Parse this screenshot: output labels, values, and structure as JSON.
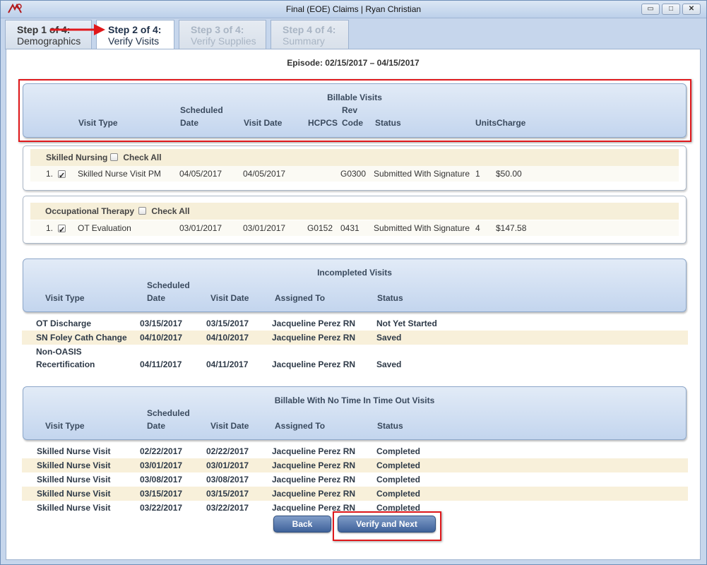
{
  "window": {
    "title": "Final (EOE) Claims | Ryan Christian",
    "minimize": "▭",
    "maximize": "□",
    "close": "✕"
  },
  "tabs": [
    {
      "step": "Step 1 of 4:",
      "name": "Demographics",
      "state": "done"
    },
    {
      "step": "Step 2 of 4:",
      "name": "Verify Visits",
      "state": "active"
    },
    {
      "step": "Step 3 of 4:",
      "name": "Verify Supplies",
      "state": "disabled"
    },
    {
      "step": "Step 4 of 4:",
      "name": "Summary",
      "state": "disabled"
    }
  ],
  "episode": "Episode: 02/15/2017 – 04/15/2017",
  "billable": {
    "title": "Billable Visits",
    "columns": {
      "visit_type": "Visit Type",
      "scheduled_1": "Scheduled",
      "scheduled_2": "Date",
      "visit_date": "Visit Date",
      "hcpcs": "HCPCS",
      "rev_1": "Rev",
      "rev_2": "Code",
      "status": "Status",
      "units": "Units",
      "charge": "Charge"
    },
    "groups": [
      {
        "name": "Skilled Nursing",
        "check_all": "Check All",
        "rows": [
          {
            "num": "1.",
            "checked": true,
            "visit_type": "Skilled Nurse Visit PM",
            "scheduled": "04/05/2017",
            "visit_date": "04/05/2017",
            "hcpcs": "",
            "rev": "G0300",
            "status": "Submitted With Signature",
            "units": "1",
            "charge": "$50.00"
          }
        ]
      },
      {
        "name": "Occupational Therapy",
        "check_all": "Check All",
        "rows": [
          {
            "num": "1.",
            "checked": true,
            "visit_type": "OT Evaluation",
            "scheduled": "03/01/2017",
            "visit_date": "03/01/2017",
            "hcpcs": "G0152",
            "rev": "0431",
            "status": "Submitted With Signature",
            "units": "4",
            "charge": "$147.58"
          }
        ]
      }
    ]
  },
  "incompleted": {
    "title": "Incompleted Visits",
    "columns": {
      "visit_type": "Visit Type",
      "scheduled_1": "Scheduled",
      "scheduled_2": "Date",
      "visit_date": "Visit Date",
      "assigned": "Assigned To",
      "status": "Status"
    },
    "rows": [
      {
        "visit_type": "OT Discharge",
        "visit_type_2": "",
        "scheduled": "03/15/2017",
        "visit_date": "03/15/2017",
        "assigned": "Jacqueline Perez RN",
        "status": "Not Yet Started"
      },
      {
        "visit_type": "SN Foley Cath Change",
        "visit_type_2": "",
        "scheduled": "04/10/2017",
        "visit_date": "04/10/2017",
        "assigned": "Jacqueline Perez RN",
        "status": "Saved"
      },
      {
        "visit_type": "Non-OASIS",
        "visit_type_2": "Recertification",
        "scheduled": "04/11/2017",
        "visit_date": "04/11/2017",
        "assigned": "Jacqueline Perez RN",
        "status": "Saved"
      }
    ]
  },
  "notime": {
    "title": "Billable With No Time In Time Out Visits",
    "columns": {
      "visit_type": "Visit Type",
      "scheduled_1": "Scheduled",
      "scheduled_2": "Date",
      "visit_date": "Visit Date",
      "assigned": "Assigned To",
      "status": "Status"
    },
    "rows": [
      {
        "visit_type": "Skilled Nurse Visit",
        "scheduled": "02/22/2017",
        "visit_date": "02/22/2017",
        "assigned": "Jacqueline Perez RN",
        "status": "Completed"
      },
      {
        "visit_type": "Skilled Nurse Visit",
        "scheduled": "03/01/2017",
        "visit_date": "03/01/2017",
        "assigned": "Jacqueline Perez RN",
        "status": "Completed"
      },
      {
        "visit_type": "Skilled Nurse Visit",
        "scheduled": "03/08/2017",
        "visit_date": "03/08/2017",
        "assigned": "Jacqueline Perez RN",
        "status": "Completed"
      },
      {
        "visit_type": "Skilled Nurse Visit",
        "scheduled": "03/15/2017",
        "visit_date": "03/15/2017",
        "assigned": "Jacqueline Perez RN",
        "status": "Completed"
      },
      {
        "visit_type": "Skilled Nurse Visit",
        "scheduled": "03/22/2017",
        "visit_date": "03/22/2017",
        "assigned": "Jacqueline Perez RN",
        "status": "Completed"
      }
    ]
  },
  "buttons": {
    "back": "Back",
    "verify_next": "Verify and Next"
  },
  "colors": {
    "highlight": "#e0181b",
    "button": "#3f629a",
    "header": "#c3d5ee",
    "alt_row": "#f8f0da"
  }
}
